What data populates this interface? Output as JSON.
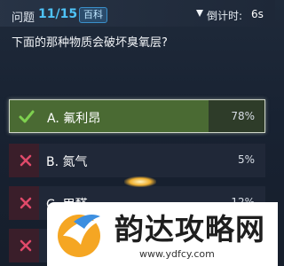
{
  "header": {
    "question_label": "问题",
    "progress": "11/15",
    "category": "百科",
    "timer_label": "倒计时:",
    "timer_value": "6s"
  },
  "question": "下面的那种物质会破坏臭氧层?",
  "colors": {
    "correct": "#6cc24a",
    "wrong": "#e04a6a",
    "accent": "#4fc3f7"
  },
  "options": [
    {
      "label": "A. 氟利昂",
      "percent": "78%",
      "share": 0.78,
      "status": "correct",
      "icon": "check-icon"
    },
    {
      "label": "B. 氮气",
      "percent": "5%",
      "share": 0.05,
      "status": "wrong",
      "icon": "cross-icon"
    },
    {
      "label": "C. 甲醛",
      "percent": "12%",
      "share": 0.12,
      "status": "wrong",
      "icon": "cross-icon"
    },
    {
      "label": "D.",
      "percent": "",
      "share": 0.05,
      "status": "wrong",
      "icon": "cross-icon"
    }
  ],
  "watermark": {
    "title": "韵达攻略网",
    "url": "www.ydfcy.com"
  }
}
